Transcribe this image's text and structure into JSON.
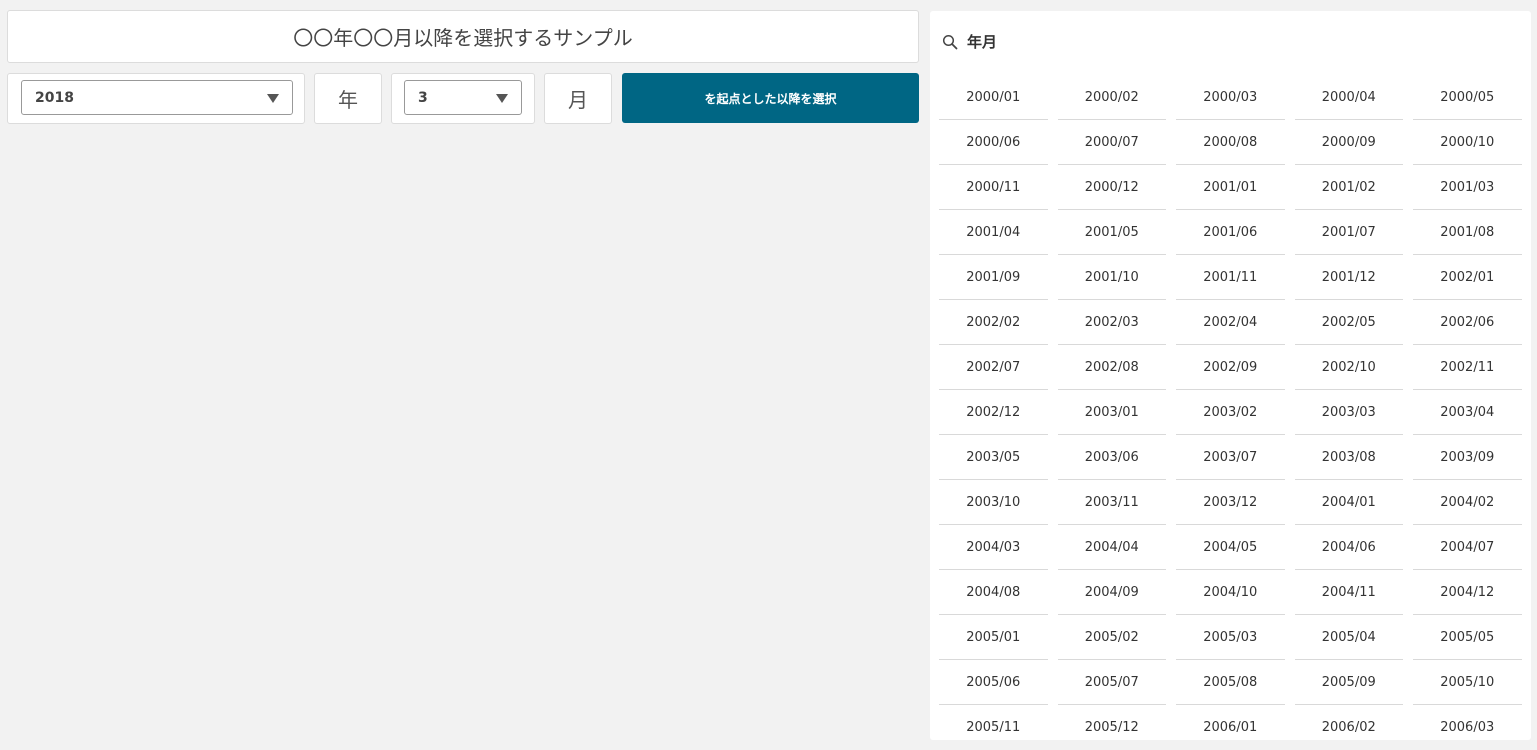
{
  "header": {
    "title": "〇〇年〇〇月以降を選択するサンプル"
  },
  "controls": {
    "year_value": "2018",
    "year_unit": "年",
    "month_value": "3",
    "month_unit": "月",
    "action_label": "を起点とした以降を選択",
    "accent_color": "#006684"
  },
  "panel": {
    "icon": "search-icon",
    "title": "年月",
    "items": [
      "2000/01",
      "2000/02",
      "2000/03",
      "2000/04",
      "2000/05",
      "2000/06",
      "2000/07",
      "2000/08",
      "2000/09",
      "2000/10",
      "2000/11",
      "2000/12",
      "2001/01",
      "2001/02",
      "2001/03",
      "2001/04",
      "2001/05",
      "2001/06",
      "2001/07",
      "2001/08",
      "2001/09",
      "2001/10",
      "2001/11",
      "2001/12",
      "2002/01",
      "2002/02",
      "2002/03",
      "2002/04",
      "2002/05",
      "2002/06",
      "2002/07",
      "2002/08",
      "2002/09",
      "2002/10",
      "2002/11",
      "2002/12",
      "2003/01",
      "2003/02",
      "2003/03",
      "2003/04",
      "2003/05",
      "2003/06",
      "2003/07",
      "2003/08",
      "2003/09",
      "2003/10",
      "2003/11",
      "2003/12",
      "2004/01",
      "2004/02",
      "2004/03",
      "2004/04",
      "2004/05",
      "2004/06",
      "2004/07",
      "2004/08",
      "2004/09",
      "2004/10",
      "2004/11",
      "2004/12",
      "2005/01",
      "2005/02",
      "2005/03",
      "2005/04",
      "2005/05",
      "2005/06",
      "2005/07",
      "2005/08",
      "2005/09",
      "2005/10",
      "2005/11",
      "2005/12",
      "2006/01",
      "2006/02",
      "2006/03"
    ]
  }
}
